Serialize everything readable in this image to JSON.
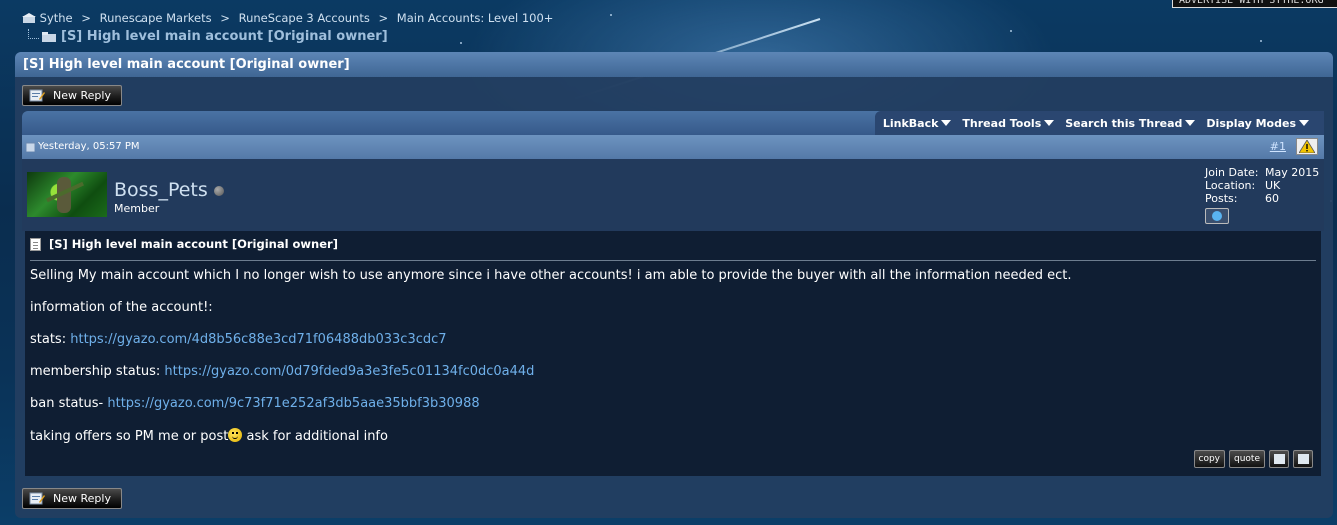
{
  "top_ad": "ADVERTISE WITH SYTHE.ORG",
  "breadcrumb": [
    "Sythe",
    "Runescape Markets",
    "RuneScape 3 Accounts",
    "Main Accounts: Level 100+"
  ],
  "breadcrumb_sep": ">",
  "thread": {
    "current_title": "[S] High level main account [Original owner]",
    "panel_title": "[S] High level main account [Original owner]"
  },
  "buttons": {
    "new_reply": "New Reply"
  },
  "thread_tools": [
    "LinkBack",
    "Thread Tools",
    "Search this Thread",
    "Display Modes"
  ],
  "post": {
    "date": "Yesterday, 05:57 PM",
    "number": "#1",
    "username": "Boss_Pets",
    "user_title": "Member",
    "join_date_label": "Join Date:",
    "join_date": "May 2015",
    "location_label": "Location:",
    "location": "UK",
    "posts_label": "Posts:",
    "posts": "60",
    "title": "[S] High level main account [Original owner]",
    "body_line1": "Selling My main account which I no longer wish to use anymore since i have other accounts! i am able to provide the buyer with all the information needed ect.",
    "body_line2": "information of the account!:",
    "stats_label": "stats:",
    "stats_link": "https://gyazo.com/4d8b56c88e3cd71f06488db033c3cdc7",
    "membership_label": "membership status:",
    "membership_link": "https://gyazo.com/0d79fded9a3e3fe5c01134fc0dc0a44d",
    "ban_label": "ban status-",
    "ban_link": "https://gyazo.com/9c73f71e252af3db5aae35bbf3b30988",
    "closing_a": "taking offers so PM me or post",
    "closing_b": " ask for additional info",
    "actions": {
      "copy": "copy",
      "quote": "quote"
    }
  },
  "colors": {
    "link": "#6fb0ea",
    "panel": "#233e61",
    "header": "#4f77a6"
  }
}
